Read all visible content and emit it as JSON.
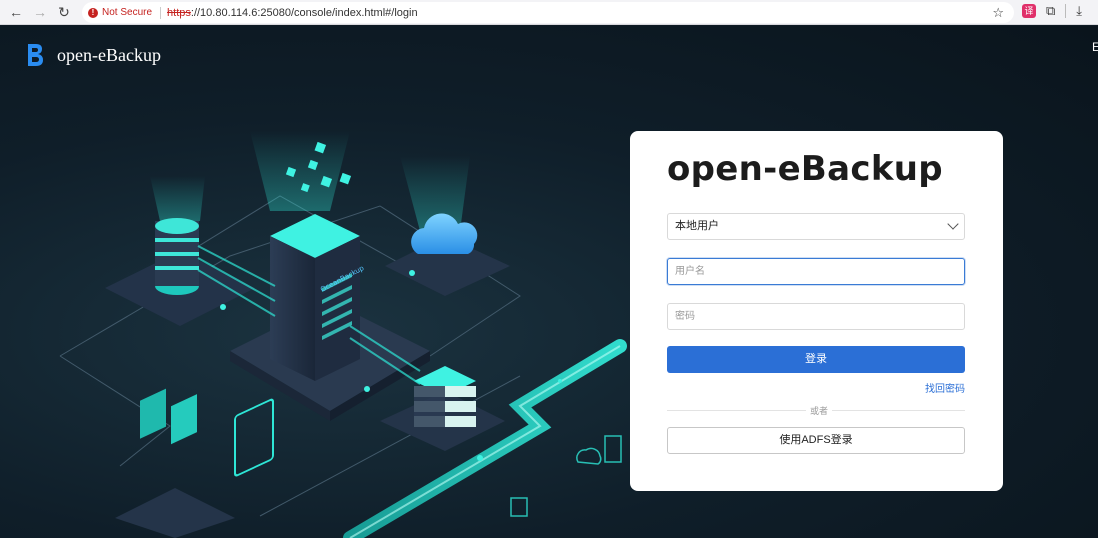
{
  "browser": {
    "security_label": "Not Secure",
    "url_scheme": "https",
    "url_rest": "://10.80.114.6:25080/console/index.html#/login"
  },
  "brand": {
    "name": "open-eBackup",
    "lang_edge": "E"
  },
  "illustration": {
    "server_label": "OceanBackup"
  },
  "login": {
    "title": "open-eBackup",
    "user_type_selected": "本地用户",
    "username_placeholder": "用户名",
    "password_placeholder": "密码",
    "login_label": "登录",
    "forgot_label": "找回密码",
    "or_label": "或者",
    "adfs_label": "使用ADFS登录"
  },
  "colors": {
    "primary": "#2b6fd6",
    "accent_cyan": "#2ee6d6",
    "bg_dark": "#0e1a24"
  }
}
